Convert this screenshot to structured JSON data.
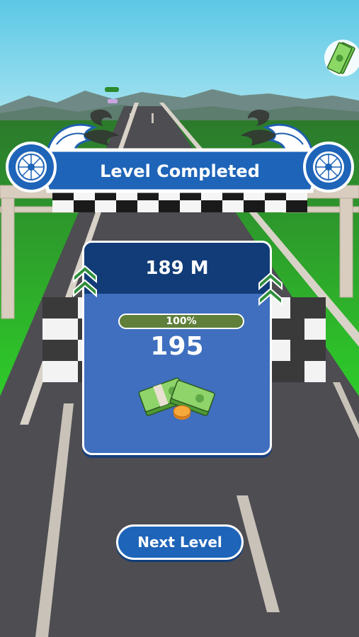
{
  "banner": {
    "title": "Level Completed"
  },
  "card": {
    "distance": "189 M",
    "progress_label": "100%",
    "progress_value": 1.0,
    "reward": "195"
  },
  "buttons": {
    "next_level": "Next Level"
  },
  "colors": {
    "accent_blue": "#1e64b8",
    "card_blue": "#3f6fbe",
    "header_navy": "#113c78",
    "progress_green": "#5f7f3a",
    "sky": "#6ecfe8",
    "grass": "#2fb82a",
    "road": "#4a4a4f"
  },
  "icons": [
    "tire-flame-icon",
    "checkered-flag-icon",
    "chevron-up-icon",
    "money-stack-icon",
    "coin-icon"
  ]
}
